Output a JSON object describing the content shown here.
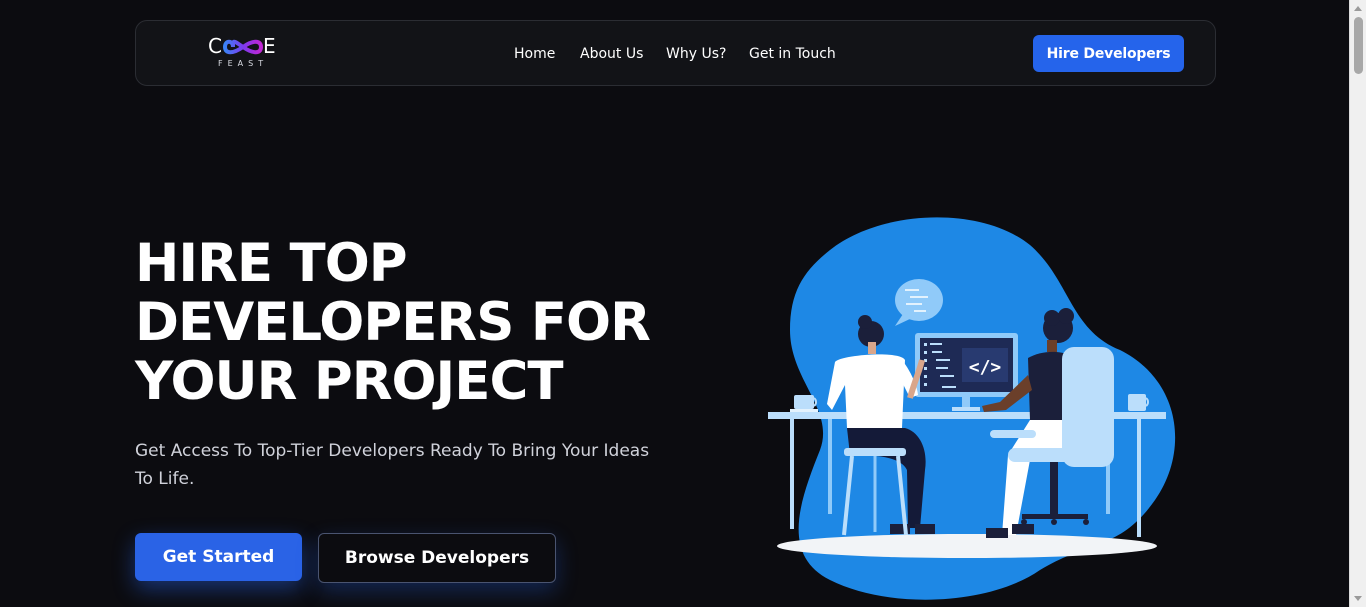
{
  "logo": {
    "text_left": "C",
    "text_right": "E",
    "subtitle": "FEAST",
    "icon": "infinity-icon"
  },
  "nav": {
    "items": [
      {
        "label": "Home"
      },
      {
        "label": "About Us"
      },
      {
        "label": "Why Us?"
      },
      {
        "label": "Get in Touch"
      }
    ],
    "cta_label": "Hire Developers"
  },
  "hero": {
    "title_lines": [
      "HIRE TOP",
      "DEVELOPERS FOR",
      "YOUR PROJECT"
    ],
    "subtitle": "Get Access To Top-Tier Developers Ready To Bring Your Ideas To Life.",
    "primary_button": "Get Started",
    "secondary_button": "Browse Developers"
  },
  "illustration": {
    "code_symbol": "</>",
    "icon": "developers-at-desk-illustration"
  },
  "colors": {
    "background": "#0c0c10",
    "accent": "#2564eb",
    "blob": "#1e88e5"
  }
}
